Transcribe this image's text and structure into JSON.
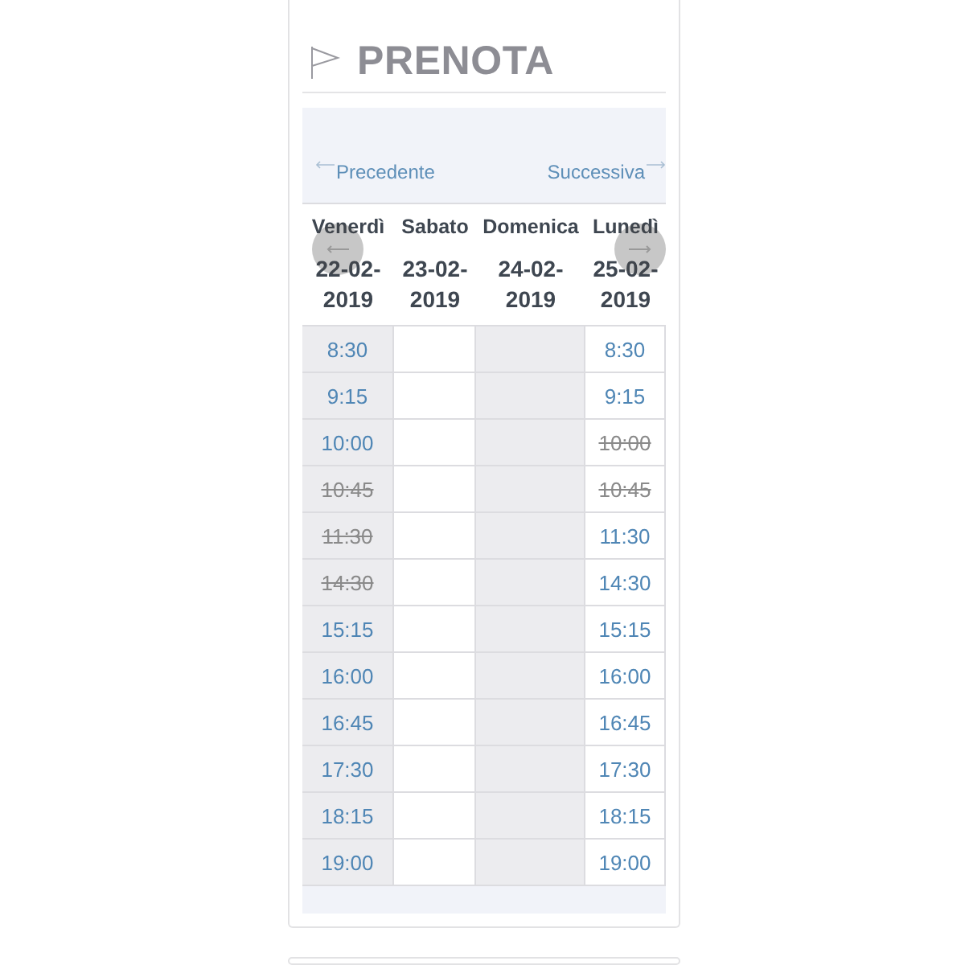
{
  "title": "PRENOTA",
  "nav": {
    "previous": "Precedente",
    "next": "Successiva"
  },
  "days": [
    {
      "name": "Venerdì",
      "date": "22-02-2019",
      "shaded": true,
      "slots": [
        {
          "time": "8:30",
          "booked": false
        },
        {
          "time": "9:15",
          "booked": false
        },
        {
          "time": "10:00",
          "booked": false
        },
        {
          "time": "10:45",
          "booked": true
        },
        {
          "time": "11:30",
          "booked": true
        },
        {
          "time": "14:30",
          "booked": true
        },
        {
          "time": "15:15",
          "booked": false
        },
        {
          "time": "16:00",
          "booked": false
        },
        {
          "time": "16:45",
          "booked": false
        },
        {
          "time": "17:30",
          "booked": false
        },
        {
          "time": "18:15",
          "booked": false
        },
        {
          "time": "19:00",
          "booked": false
        }
      ]
    },
    {
      "name": "Sabato",
      "date": "23-02-2019",
      "shaded": false
    },
    {
      "name": "Domenica",
      "date": "24-02-2019",
      "shaded": true
    },
    {
      "name": "Lunedì",
      "date": "25-02-2019",
      "shaded": false,
      "slots": [
        {
          "time": "8:30",
          "booked": false
        },
        {
          "time": "9:15",
          "booked": false
        },
        {
          "time": "10:00",
          "booked": true
        },
        {
          "time": "10:45",
          "booked": true
        },
        {
          "time": "11:30",
          "booked": false
        },
        {
          "time": "14:30",
          "booked": false
        },
        {
          "time": "15:15",
          "booked": false
        },
        {
          "time": "16:00",
          "booked": false
        },
        {
          "time": "16:45",
          "booked": false
        },
        {
          "time": "17:30",
          "booked": false
        },
        {
          "time": "18:15",
          "booked": false
        },
        {
          "time": "19:00",
          "booked": false
        }
      ]
    }
  ]
}
